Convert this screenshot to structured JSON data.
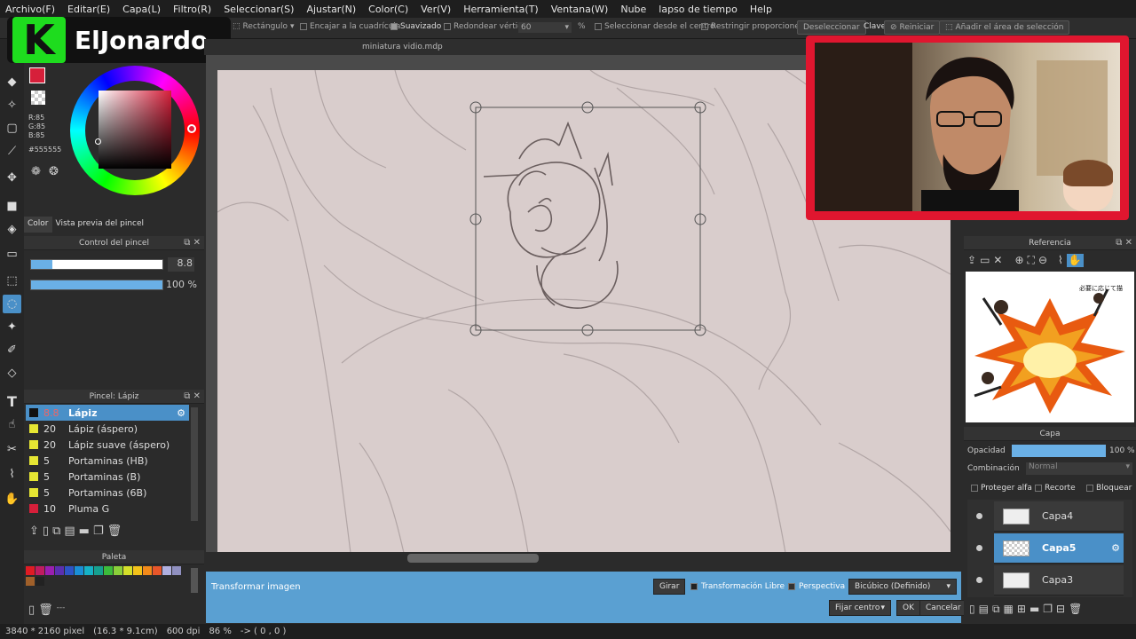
{
  "menu": [
    "Archivo(F)",
    "Editar(E)",
    "Capa(L)",
    "Filtro(R)",
    "Seleccionar(S)",
    "Ajustar(N)",
    "Color(C)",
    "Ver(V)",
    "Herramienta(T)",
    "Ventana(W)",
    "Nube",
    "lapso de tiempo",
    "Help"
  ],
  "options": {
    "shape": "Rectángulo",
    "snap": "Encajar a la cuadrícula",
    "smooth": "Suavizado",
    "round": "Redondear vértice",
    "round_value": "60",
    "percent": "%",
    "from_center": "Seleccionar desde el centro",
    "restrict": "Restringir proporciones",
    "deselect": "Deseleccionar",
    "clave": "Clave",
    "reset": "Reiniciar",
    "add_selection": "Añadir el área de selección"
  },
  "logo": {
    "letter": "K",
    "name": "ElJonardo"
  },
  "color": {
    "r": "R:85",
    "g": "G:85",
    "b": "B:85",
    "hex": "#555555",
    "tab_color": "Color",
    "tab_preview": "Vista previa del pincel",
    "accent": "#d61f3a"
  },
  "brush_control": {
    "title": "Control del pincel",
    "size": "8.8",
    "opacity": "100 %"
  },
  "brush_list": {
    "title": "Pincel: Lápiz",
    "items": [
      {
        "size": "8.8",
        "name": "Lápiz",
        "color": "#111111"
      },
      {
        "size": "20",
        "name": "Lápiz (áspero)",
        "color": "#e6e633"
      },
      {
        "size": "20",
        "name": "Lápiz suave (áspero)",
        "color": "#e6e633"
      },
      {
        "size": "5",
        "name": "Portaminas (HB)",
        "color": "#e6e633"
      },
      {
        "size": "5",
        "name": "Portaminas (B)",
        "color": "#e6e633"
      },
      {
        "size": "5",
        "name": "Portaminas (6B)",
        "color": "#e6e633"
      },
      {
        "size": "10",
        "name": "Pluma G",
        "color": "#d61f3a"
      }
    ]
  },
  "palette": {
    "title": "Paleta",
    "more": "---"
  },
  "document": {
    "title": "miniatura vidio.mdp"
  },
  "transform": {
    "title": "Transformar imagen",
    "rotate": "Girar",
    "free": "Transformación Libre",
    "perspective": "Perspectiva",
    "interp": "Bicúbico (Definido)",
    "fix_center": "Fijar centro",
    "ok": "OK",
    "cancel": "Cancelar"
  },
  "status": {
    "size": "3840 * 2160 pixel",
    "cm": "(16.3 * 9.1cm)",
    "dpi": "600 dpi",
    "zoom": "86 %",
    "coords": "-> ( 0 , 0 )"
  },
  "reference": {
    "title": "Referencia",
    "ref_text": "必要に応じて描"
  },
  "layers": {
    "title": "Capa",
    "opacity_label": "Opacidad",
    "opacity_value": "100 %",
    "blend_label": "Combinación",
    "blend_value": "Normal",
    "protect": "Proteger alfa",
    "clip": "Recorte",
    "lock": "Bloquear",
    "items": [
      "Capa4",
      "Capa5",
      "Capa3"
    ]
  }
}
